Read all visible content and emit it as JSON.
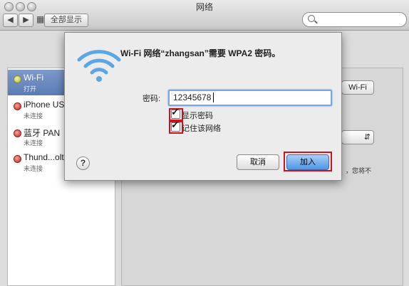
{
  "window": {
    "title": "网络"
  },
  "toolbar": {
    "show_all_label": "全部显示"
  },
  "sidebar": {
    "items": [
      {
        "name": "Wi-Fi",
        "status": "打开",
        "dot": "green"
      },
      {
        "name": "iPhone USB",
        "status": "未连接",
        "dot": "red"
      },
      {
        "name": "蓝牙 PAN",
        "status": "未连接",
        "dot": "red"
      },
      {
        "name": "Thund...olt",
        "status": "未连接",
        "dot": "red"
      }
    ]
  },
  "pane": {
    "partial_button": "Wi-Fi",
    "partial_text": "，您将不"
  },
  "dialog": {
    "title": "Wi-Fi 网络“zhangsan”需要 WPA2 密码。",
    "password_label": "密码:",
    "password_value": "12345678",
    "show_password_label": "显示密码",
    "remember_label": "记住该网络",
    "help_label": "?",
    "cancel_label": "取消",
    "join_label": "加入"
  },
  "colors": {
    "highlight_red": "#d1121e",
    "selection_blue": "#5a7cb6",
    "default_button": "#4f97e6"
  }
}
